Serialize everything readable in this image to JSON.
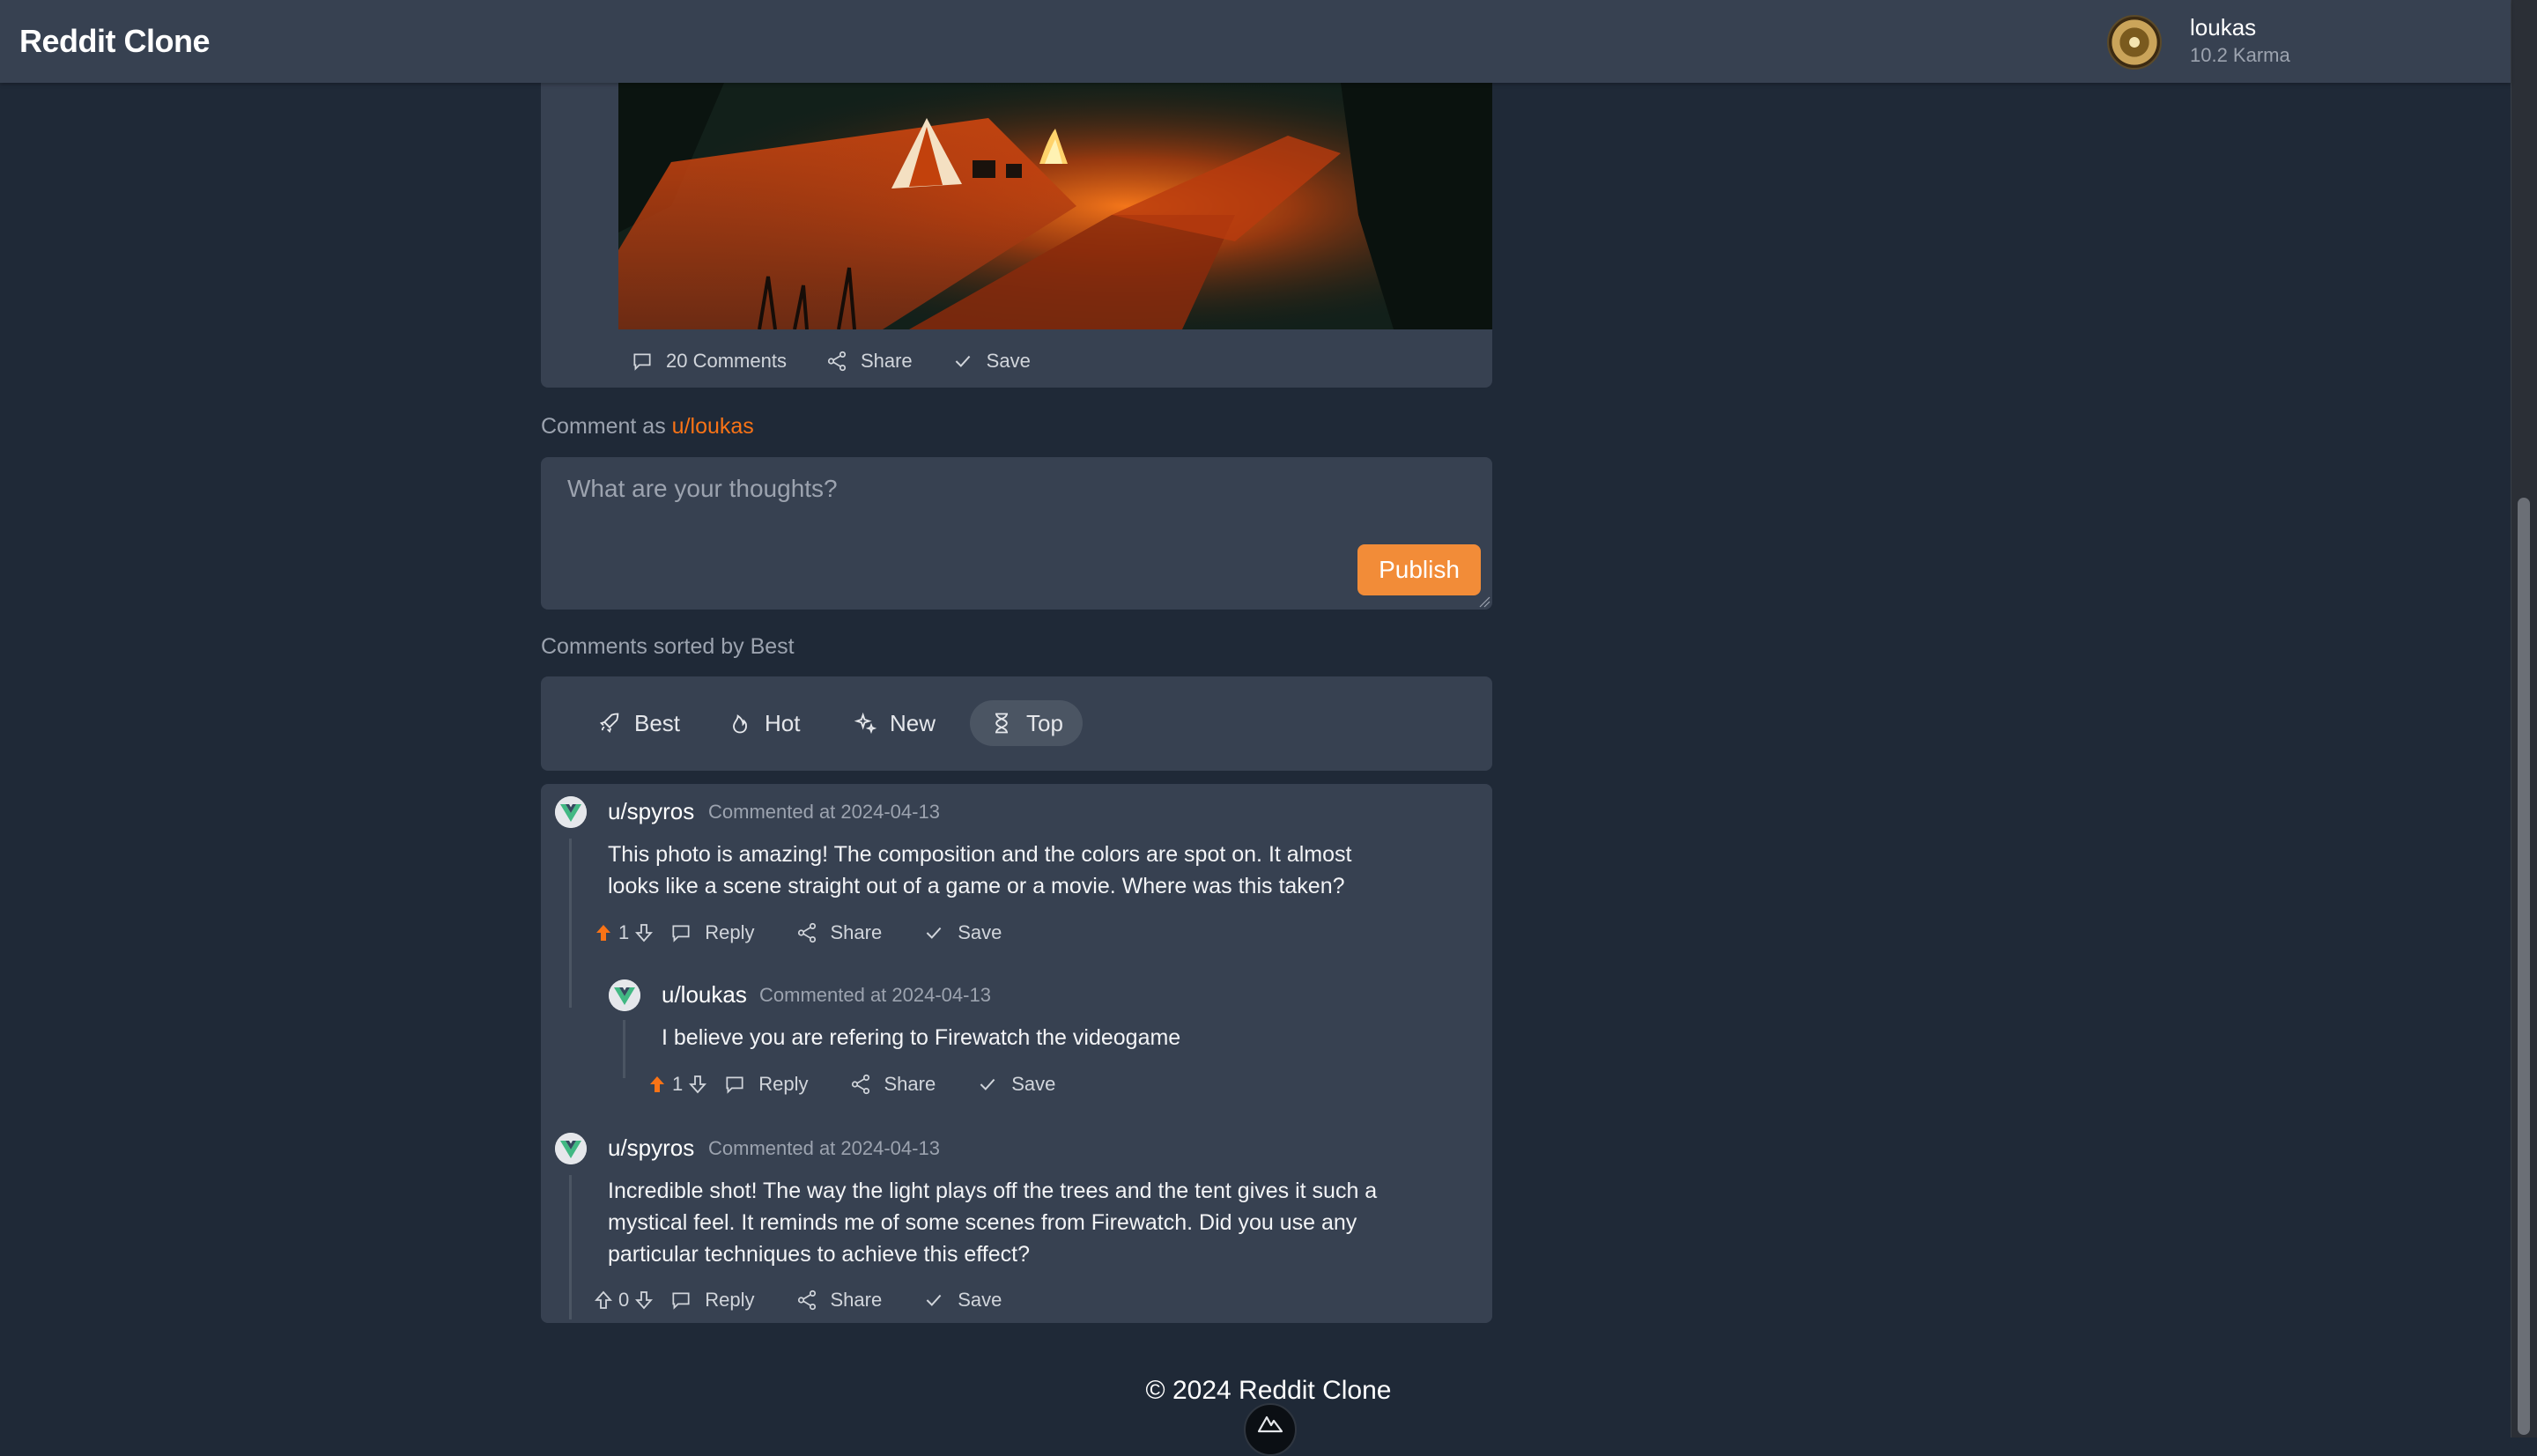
{
  "app": {
    "brand": "Reddit Clone"
  },
  "user": {
    "name": "loukas",
    "karma": "10.2 Karma"
  },
  "post": {
    "actions": {
      "comments": "20 Comments",
      "share": "Share",
      "save": "Save"
    }
  },
  "composer": {
    "prefix": "Comment as ",
    "username": "u/loukas",
    "placeholder": "What are your thoughts?",
    "publish": "Publish"
  },
  "sort": {
    "label": "Comments sorted by Best",
    "options": [
      "Best",
      "Hot",
      "New",
      "Top"
    ],
    "selected": "Top"
  },
  "comments": [
    {
      "user": "u/spyros",
      "time": "Commented at 2024-04-13",
      "lines": [
        "This photo is amazing! The composition and the colors are spot on. It almost",
        "looks like a scene straight out of a game or a movie. Where was this taken?"
      ],
      "score": "1",
      "reply": "Reply",
      "share": "Share",
      "save": "Save",
      "replies": [
        {
          "user": "u/loukas",
          "time": "Commented at 2024-04-13",
          "lines": [
            "I believe you are refering to Firewatch the videogame"
          ],
          "score": "1",
          "reply": "Reply",
          "share": "Share",
          "save": "Save"
        }
      ]
    },
    {
      "user": "u/spyros",
      "time": "Commented at 2024-04-13",
      "lines": [
        "Incredible shot! The way the light plays off the trees and the tent gives it such a",
        "mystical feel. It reminds me of some scenes from Firewatch. Did you use any",
        "particular techniques to achieve this effect?"
      ],
      "score": "0",
      "reply": "Reply",
      "share": "Share",
      "save": "Save"
    }
  ],
  "footer": {
    "text": "© 2024 Reddit Clone"
  },
  "colors": {
    "accent": "#f97316",
    "publish": "#f28c38",
    "bg": "#1f2937",
    "card": "#374151"
  }
}
